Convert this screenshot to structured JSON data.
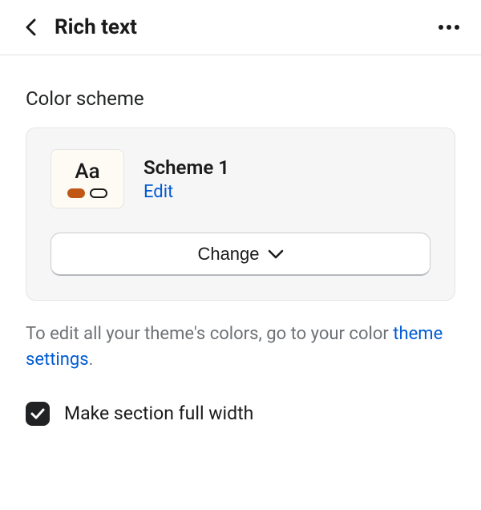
{
  "header": {
    "title": "Rich text"
  },
  "colorScheme": {
    "label": "Color scheme",
    "swatch_text": "Aa",
    "scheme_name": "Scheme 1",
    "edit_label": "Edit",
    "change_label": "Change"
  },
  "helpText": {
    "prefix": "To edit all your theme's colors, go to your color ",
    "link_text": "theme settings",
    "suffix": "."
  },
  "fullWidth": {
    "label": "Make section full width",
    "checked": true
  }
}
